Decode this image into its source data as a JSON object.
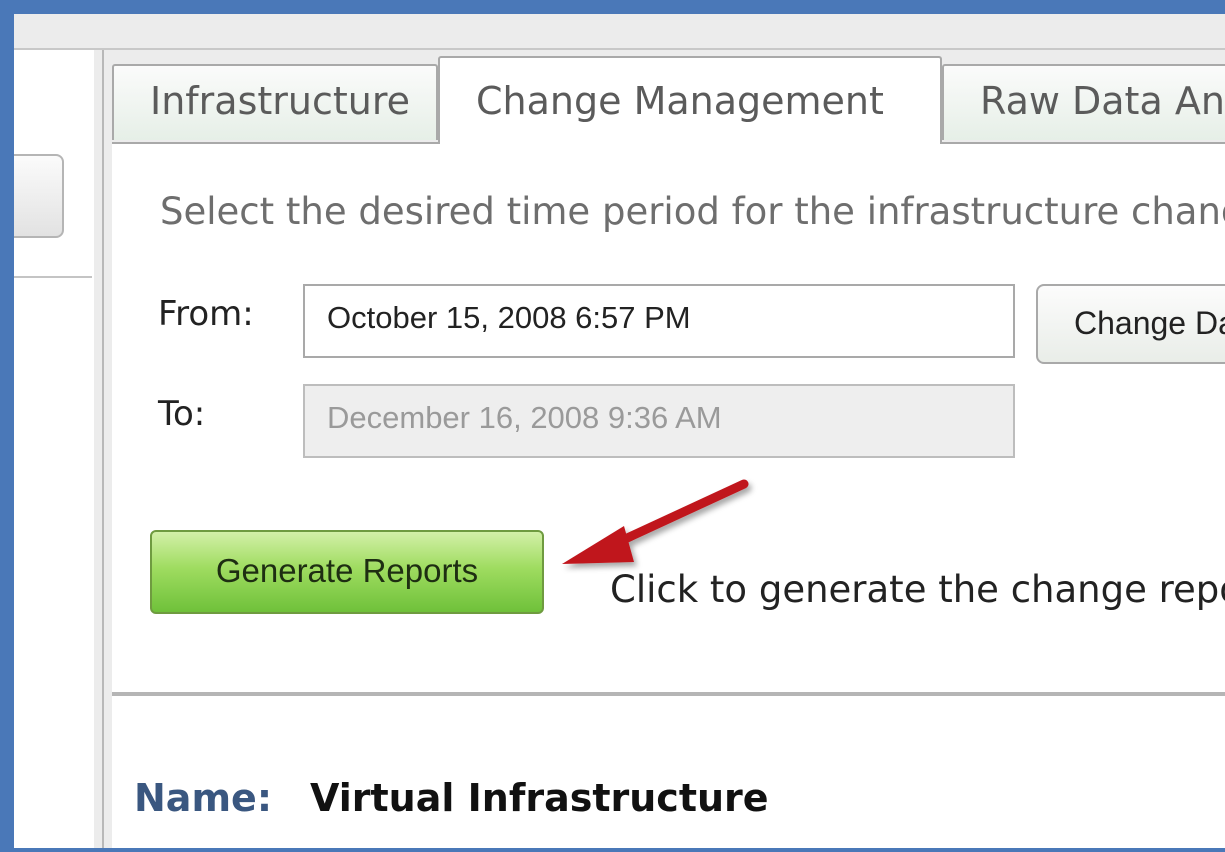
{
  "tabs": [
    {
      "label": "Infrastructure"
    },
    {
      "label": "Change Management",
      "active": true
    },
    {
      "label": "Raw Data Analysis"
    }
  ],
  "change_management": {
    "instruction": "Select the desired time period for the infrastructure change reports.",
    "from_label": "From:",
    "from_value": "October 15, 2008 6:57 PM",
    "to_label": "To:",
    "to_value": "December 16, 2008 9:36 AM",
    "change_button": "Change Date",
    "generate_button": "Generate Reports",
    "generate_hint": "Click to generate the change reports"
  },
  "details": {
    "name_label": "Name:",
    "name_value": "Virtual Infrastructure"
  },
  "colors": {
    "frame_border": "#4a78b8",
    "generate_button": "#8fd452",
    "annotation_arrow": "#c0141c",
    "name_label": "#3a5780"
  },
  "icons": {
    "annotation": "red-arrow-icon"
  }
}
